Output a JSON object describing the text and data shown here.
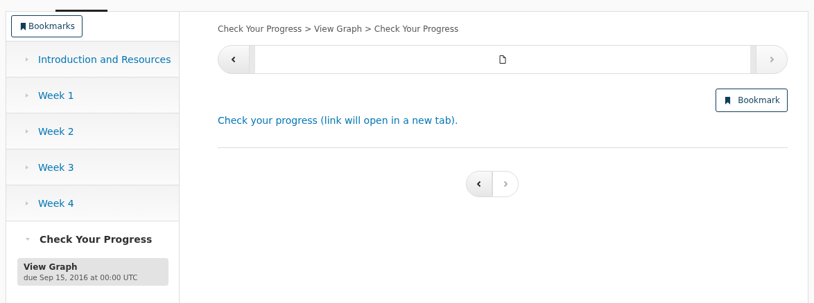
{
  "sidebar": {
    "bookmarks_button": "Bookmarks",
    "sections": [
      {
        "title": "Introduction and Resources",
        "expanded": false
      },
      {
        "title": "Week 1",
        "expanded": false
      },
      {
        "title": "Week 2",
        "expanded": false
      },
      {
        "title": "Week 3",
        "expanded": false
      },
      {
        "title": "Week 4",
        "expanded": false
      },
      {
        "title": "Check Your Progress",
        "expanded": true,
        "children": [
          {
            "title": "View Graph",
            "due": "due Sep 15, 2016 at 00:00 UTC",
            "selected": true
          }
        ]
      }
    ]
  },
  "breadcrumb": "Check Your Progress > View Graph > Check Your Progress",
  "sequence_nav": {
    "prev_disabled": false,
    "next_disabled": true
  },
  "bookmark_button": "Bookmark",
  "content_link": "Check your progress (link will open in a new tab).",
  "bottom_nav": {
    "prev_disabled": false,
    "next_disabled": true
  }
}
